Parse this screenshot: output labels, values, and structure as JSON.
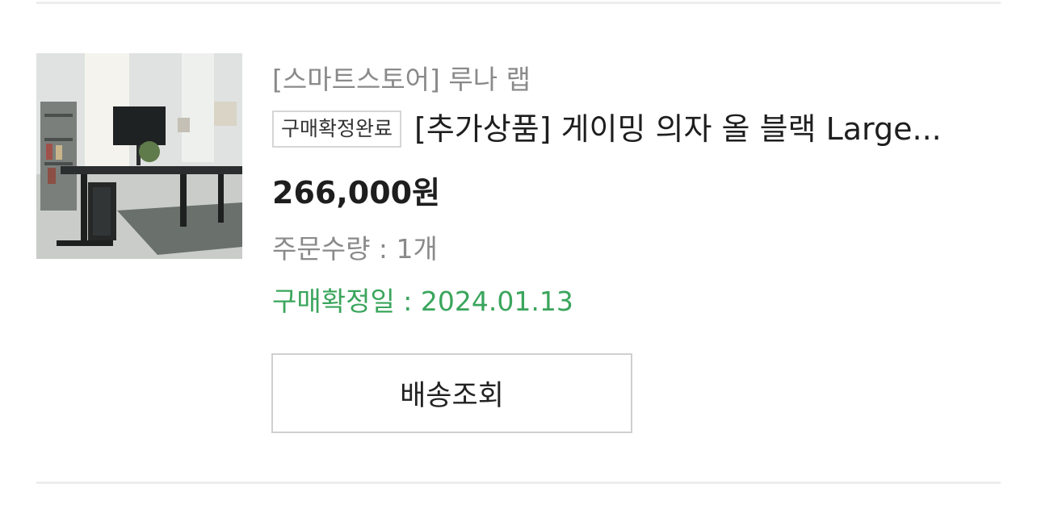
{
  "order_item": {
    "store": "[스마트스토어] 루나 랩",
    "status_badge": "구매확정완료",
    "product_title": "[추가상품] 게이밍 의자 올 블랙 Large...",
    "price": "266,000원",
    "quantity": "주문수량 : 1개",
    "confirmed_date": "구매확정일 : 2024.01.13",
    "track_button_label": "배송조회",
    "thumbnail_icon": "product-photo-desk-room"
  },
  "colors": {
    "confirmed_text": "#3aa55c",
    "muted_text": "#8a8a8a",
    "primary_text": "#1e1e1e",
    "border": "#cfcfcf"
  }
}
